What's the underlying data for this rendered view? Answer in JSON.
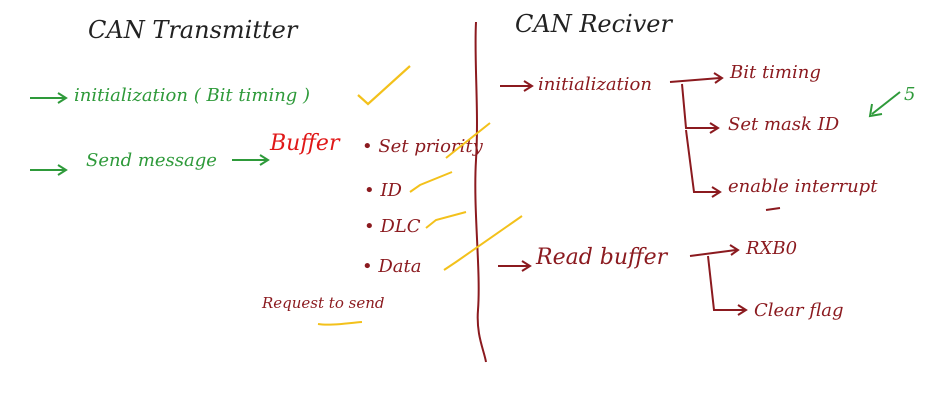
{
  "colors": {
    "black": "#222222",
    "green": "#2e9a3a",
    "red": "#e01818",
    "maroon": "#8b1a1f",
    "yellow": "#f3c11b"
  },
  "transmitter": {
    "title": "CAN Transmitter",
    "step1": "initialization ( Bit timing )",
    "step2": "Send message",
    "buffer_label": "Buffer",
    "buffer_items": [
      "• Set priority",
      "• ID",
      "• DLC",
      "• Data"
    ],
    "request": "Request to send"
  },
  "receiver": {
    "title": "CAN Reciver",
    "step1": "initialization",
    "branch_bit": "Bit timing",
    "branch_mask": "Set mask ID",
    "branch_mask_note": "5",
    "branch_int": "enable interrupt",
    "step2": "Read buffer",
    "branch_rxb": "RXB0",
    "branch_clear": "Clear flag"
  }
}
